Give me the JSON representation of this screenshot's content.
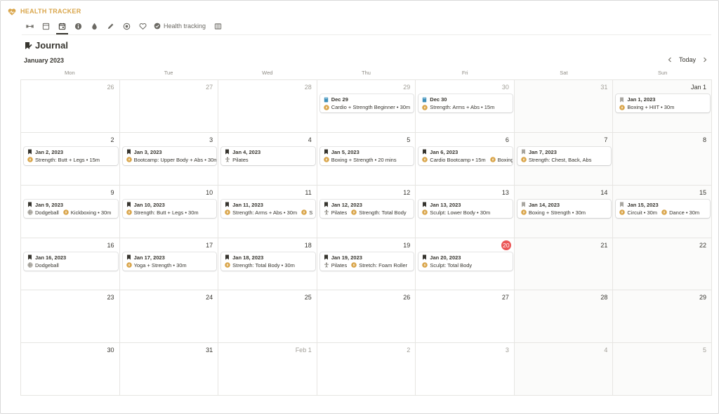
{
  "app": {
    "title": "HEALTH TRACKER",
    "accent": "#d9a54a",
    "logo_icon": "heart-icon"
  },
  "tabs": [
    {
      "name": "tab-horizontal-arrows",
      "icon": "arrows-icon"
    },
    {
      "name": "tab-table",
      "icon": "table-icon"
    },
    {
      "name": "tab-calendar",
      "icon": "calendar-icon",
      "active": true
    },
    {
      "name": "tab-info",
      "icon": "info-icon"
    },
    {
      "name": "tab-drop",
      "icon": "drop-icon"
    },
    {
      "name": "tab-pen",
      "icon": "pen-icon"
    },
    {
      "name": "tab-target",
      "icon": "target-icon"
    },
    {
      "name": "tab-heart",
      "icon": "heart-outline-icon"
    }
  ],
  "tab_text": {
    "label": "Health tracking",
    "icon": "check-circle-icon"
  },
  "page": {
    "title": "Journal",
    "title_icon": "journal-icon"
  },
  "calendar": {
    "month_label": "January 2023",
    "today_label": "Today",
    "weekdays": [
      "Mon",
      "Tue",
      "Wed",
      "Thu",
      "Fri",
      "Sat",
      "Sun"
    ],
    "today_color": "#eb5757",
    "weeks": [
      [
        {
          "day": "26",
          "outside": true
        },
        {
          "day": "27",
          "outside": true
        },
        {
          "day": "28",
          "outside": true
        },
        {
          "day": "29",
          "outside": true,
          "card": {
            "title": "Dec 29",
            "icon": "blue-book-icon",
            "tags": [
              {
                "icon": "bolt-circle-icon",
                "text": "Cardio + Strength Beginner • 30m"
              }
            ]
          }
        },
        {
          "day": "30",
          "outside": true,
          "card": {
            "title": "Dec 30",
            "icon": "blue-book-icon",
            "tags": [
              {
                "icon": "bolt-circle-icon",
                "text": "Strength: Arms + Abs • 15m"
              }
            ]
          }
        },
        {
          "day": "31",
          "outside": true
        },
        {
          "day": "Jan 1",
          "card": {
            "title": "Jan 1, 2023",
            "icon": "grey-bookmark-icon",
            "tags": [
              {
                "icon": "bolt-circle-icon",
                "text": "Boxing + HIIT • 30m"
              }
            ]
          }
        }
      ],
      [
        {
          "day": "2",
          "card": {
            "title": "Jan 2, 2023",
            "icon": "black-bookmark-icon",
            "tags": [
              {
                "icon": "bolt-circle-icon",
                "text": "Strength: Butt + Legs • 15m"
              }
            ]
          }
        },
        {
          "day": "3",
          "card": {
            "title": "Jan 3, 2023",
            "icon": "black-bookmark-icon",
            "tags": [
              {
                "icon": "bolt-circle-icon",
                "text": "Bootcamp: Upper Body + Abs • 30m"
              }
            ]
          }
        },
        {
          "day": "4",
          "card": {
            "title": "Jan 4, 2023",
            "icon": "black-bookmark-icon",
            "tags": [
              {
                "icon": "yoga-icon",
                "text": "Pilates"
              }
            ]
          }
        },
        {
          "day": "5",
          "card": {
            "title": "Jan 5, 2023",
            "icon": "black-bookmark-icon",
            "tags": [
              {
                "icon": "bolt-circle-icon",
                "text": "Boxing + Strength • 20 mins"
              }
            ]
          }
        },
        {
          "day": "6",
          "card": {
            "title": "Jan 6, 2023",
            "icon": "black-bookmark-icon",
            "tags": [
              {
                "icon": "bolt-circle-icon",
                "text": "Cardio Bootcamp • 15m"
              },
              {
                "icon": "bolt-circle-icon",
                "text": "Boxing"
              }
            ]
          }
        },
        {
          "day": "7",
          "card": {
            "title": "Jan 7, 2023",
            "icon": "grey-bookmark-icon",
            "tags": [
              {
                "icon": "bolt-circle-icon",
                "text": "Strength: Chest, Back, Abs"
              }
            ]
          }
        },
        {
          "day": "8"
        }
      ],
      [
        {
          "day": "9",
          "card": {
            "title": "Jan 9, 2023",
            "icon": "black-bookmark-icon",
            "tags": [
              {
                "icon": "ball-icon",
                "text": "Dodgeball"
              },
              {
                "icon": "bolt-circle-icon",
                "text": "Kickboxing • 30m"
              }
            ]
          }
        },
        {
          "day": "10",
          "card": {
            "title": "Jan 10, 2023",
            "icon": "black-bookmark-icon",
            "tags": [
              {
                "icon": "bolt-circle-icon",
                "text": "Strength: Butt + Legs • 30m"
              }
            ]
          }
        },
        {
          "day": "11",
          "card": {
            "title": "Jan 11, 2023",
            "icon": "black-bookmark-icon",
            "tags": [
              {
                "icon": "bolt-circle-icon",
                "text": "Strength: Arms + Abs • 30m"
              },
              {
                "icon": "bolt-circle-icon",
                "text": "S"
              }
            ]
          }
        },
        {
          "day": "12",
          "card": {
            "title": "Jan 12, 2023",
            "icon": "black-bookmark-icon",
            "tags": [
              {
                "icon": "yoga-icon",
                "text": "Pilates"
              },
              {
                "icon": "bolt-circle-icon",
                "text": "Strength: Total Body"
              }
            ]
          }
        },
        {
          "day": "13",
          "card": {
            "title": "Jan 13, 2023",
            "icon": "black-bookmark-icon",
            "tags": [
              {
                "icon": "bolt-circle-icon",
                "text": "Sculpt: Lower Body • 30m"
              }
            ]
          }
        },
        {
          "day": "14",
          "card": {
            "title": "Jan 14, 2023",
            "icon": "grey-bookmark-icon",
            "tags": [
              {
                "icon": "bolt-circle-icon",
                "text": "Boxing + Strength • 30m"
              }
            ]
          }
        },
        {
          "day": "15",
          "card": {
            "title": "Jan 15, 2023",
            "icon": "grey-bookmark-icon",
            "tags": [
              {
                "icon": "bolt-circle-icon",
                "text": "Circuit • 30m"
              },
              {
                "icon": "bolt-circle-icon",
                "text": "Dance • 30m"
              }
            ]
          }
        }
      ],
      [
        {
          "day": "16",
          "card": {
            "title": "Jan 16, 2023",
            "icon": "black-bookmark-icon",
            "tags": [
              {
                "icon": "ball-icon",
                "text": "Dodgeball"
              }
            ]
          }
        },
        {
          "day": "17",
          "card": {
            "title": "Jan 17, 2023",
            "icon": "black-bookmark-icon",
            "tags": [
              {
                "icon": "bolt-circle-icon",
                "text": "Yoga + Strength • 30m"
              }
            ]
          }
        },
        {
          "day": "18",
          "card": {
            "title": "Jan 18, 2023",
            "icon": "black-bookmark-icon",
            "tags": [
              {
                "icon": "bolt-circle-icon",
                "text": "Strength: Total Body • 30m"
              }
            ]
          }
        },
        {
          "day": "19",
          "card": {
            "title": "Jan 19, 2023",
            "icon": "black-bookmark-icon",
            "tags": [
              {
                "icon": "yoga-icon",
                "text": "Pilates"
              },
              {
                "icon": "bolt-circle-icon",
                "text": "Stretch: Foam Roller"
              }
            ]
          }
        },
        {
          "day": "20",
          "today": true,
          "card": {
            "title": "Jan 20, 2023",
            "icon": "black-bookmark-icon",
            "tags": [
              {
                "icon": "bolt-circle-icon",
                "text": "Sculpt: Total Body"
              }
            ]
          }
        },
        {
          "day": "21"
        },
        {
          "day": "22"
        }
      ],
      [
        {
          "day": "23"
        },
        {
          "day": "24"
        },
        {
          "day": "25"
        },
        {
          "day": "26"
        },
        {
          "day": "27"
        },
        {
          "day": "28"
        },
        {
          "day": "29"
        }
      ],
      [
        {
          "day": "30"
        },
        {
          "day": "31"
        },
        {
          "day": "Feb 1",
          "outside": true
        },
        {
          "day": "2",
          "outside": true
        },
        {
          "day": "3",
          "outside": true
        },
        {
          "day": "4",
          "outside": true
        },
        {
          "day": "5",
          "outside": true
        }
      ]
    ]
  }
}
